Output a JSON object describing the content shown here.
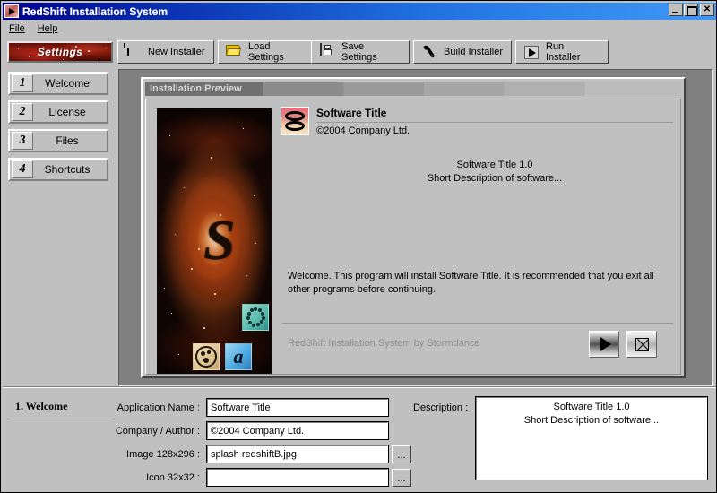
{
  "window": {
    "title": "RedShift Installation System",
    "icon": "play-triangle-icon",
    "controls": {
      "minimize": "_",
      "maximize": "□",
      "close": "✕"
    }
  },
  "menubar": {
    "items": [
      {
        "label": "File"
      },
      {
        "label": "Help"
      }
    ]
  },
  "toolbar": {
    "settings_tab": "Settings",
    "buttons": [
      {
        "label": "New Installer",
        "icon": "document-icon"
      },
      {
        "label": "Load Settings",
        "icon": "folder-icon"
      },
      {
        "label": "Save Settings",
        "icon": "floppy-disk-icon"
      },
      {
        "label": "Build Installer",
        "icon": "wrench-icon"
      },
      {
        "label": "Run Installer",
        "icon": "play-icon"
      }
    ]
  },
  "sidebar": {
    "items": [
      {
        "number": "1",
        "label": "Welcome"
      },
      {
        "number": "2",
        "label": "License"
      },
      {
        "number": "3",
        "label": "Files"
      },
      {
        "number": "4",
        "label": "Shortcuts"
      }
    ]
  },
  "preview": {
    "caption": "Installation Preview",
    "app_title": "Software Title",
    "company": "©2004 Company Ltd.",
    "description_line1": "Software Title 1.0",
    "description_line2": "Short Description of software...",
    "welcome_text": "Welcome.  This program will install Software Title.  It is recommended that you exit all other programs before continuing.",
    "credit": "RedShift Installation System by Stormdance",
    "next_button": "play-icon",
    "cancel_button": "close-x-icon"
  },
  "form": {
    "step": "1. Welcome",
    "fields": [
      {
        "label": "Application Name :",
        "value": "Software Title",
        "placeholder": "",
        "browse": false
      },
      {
        "label": "Company / Author :",
        "value": "©2004 Company Ltd.",
        "placeholder": "",
        "browse": false
      },
      {
        "label": "Image 128x296 :",
        "value": "splash redshiftB.jpg",
        "placeholder": "",
        "browse": true
      },
      {
        "label": "Icon 32x32 :",
        "value": "",
        "placeholder": "",
        "browse": true
      }
    ],
    "browse_label": "...",
    "description_label": "Description :",
    "description_line1": "Software Title 1.0",
    "description_line2": "Short Description of software..."
  },
  "colors": {
    "titlebar_start": "#00008f",
    "titlebar_end": "#3f97f5",
    "face": "#c0c0c0",
    "panel_shadow": "#808080",
    "accent_red": "#8d1d0c"
  }
}
